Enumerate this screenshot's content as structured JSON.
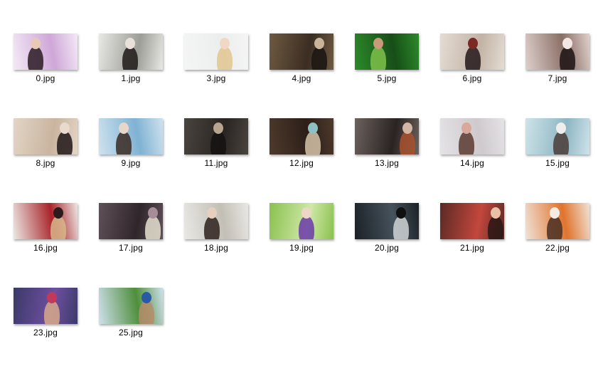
{
  "files": [
    {
      "name": "0.jpg",
      "colors": [
        "#f3e9f5",
        "#cfa7d9",
        "#2a1a22",
        "#e8c9b8"
      ]
    },
    {
      "name": "1.jpg",
      "colors": [
        "#e8e8e4",
        "#9d9d97",
        "#1d1a18",
        "#e9e0d9"
      ]
    },
    {
      "name": "3.jpg",
      "colors": [
        "#f4f5f4",
        "#eceeed",
        "#e1c58f",
        "#f1d8c6"
      ]
    },
    {
      "name": "4.jpg",
      "colors": [
        "#6f5a42",
        "#3b2d22",
        "#1a1512",
        "#c9b59b"
      ]
    },
    {
      "name": "5.jpg",
      "colors": [
        "#2d8a2a",
        "#174e18",
        "#7fc14a",
        "#c89a7a"
      ]
    },
    {
      "name": "6.jpg",
      "colors": [
        "#e4dcd3",
        "#c3b3a6",
        "#24181a",
        "#7a2a24"
      ]
    },
    {
      "name": "7.jpg",
      "colors": [
        "#dfd0cc",
        "#8a6f66",
        "#1c1414",
        "#f2e7e2"
      ]
    },
    {
      "name": "8.jpg",
      "colors": [
        "#e3d5c6",
        "#c9b49f",
        "#1e1616",
        "#e9d9cf"
      ]
    },
    {
      "name": "9.jpg",
      "colors": [
        "#cfe2ee",
        "#7fb2d3",
        "#3a2a22",
        "#e8d6c8"
      ]
    },
    {
      "name": "11.jpg",
      "colors": [
        "#4a443f",
        "#2a2522",
        "#151212",
        "#b7a590"
      ]
    },
    {
      "name": "12.jpg",
      "colors": [
        "#4e3a2c",
        "#2b1f18",
        "#d6c3a9",
        "#8ec0c4"
      ]
    },
    {
      "name": "13.jpg",
      "colors": [
        "#6c625e",
        "#2a2322",
        "#a8512e",
        "#d2b5a2"
      ]
    },
    {
      "name": "14.jpg",
      "colors": [
        "#e4e3e6",
        "#cfc9cc",
        "#5b3a30",
        "#d9a89a"
      ]
    },
    {
      "name": "15.jpg",
      "colors": [
        "#cfe3e9",
        "#8db6c3",
        "#4a3d3a",
        "#f0eded"
      ]
    },
    {
      "name": "16.jpg",
      "colors": [
        "#ece8e4",
        "#a9232a",
        "#d7b78a",
        "#2a1b1c"
      ]
    },
    {
      "name": "17.jpg",
      "colors": [
        "#5f5058",
        "#2f262a",
        "#e5e0cf",
        "#a68d96"
      ]
    },
    {
      "name": "18.jpg",
      "colors": [
        "#e9e8e4",
        "#c3bfb6",
        "#2e211c",
        "#e6cfbc"
      ]
    },
    {
      "name": "19.jpg",
      "colors": [
        "#8ac14e",
        "#cfe7a8",
        "#6a3aa8",
        "#ecd7c6"
      ]
    },
    {
      "name": "20.jpg",
      "colors": [
        "#1b2126",
        "#46525c",
        "#cfd3d5",
        "#0e1012"
      ]
    },
    {
      "name": "21.jpg",
      "colors": [
        "#5a2a25",
        "#c3473d",
        "#2a1615",
        "#e9c0a8"
      ]
    },
    {
      "name": "22.jpg",
      "colors": [
        "#f0e2d6",
        "#e0742e",
        "#4a2f22",
        "#f4ece4"
      ]
    },
    {
      "name": "23.jpg",
      "colors": [
        "#3b3a68",
        "#6e4fa0",
        "#d8a98a",
        "#c23a5a"
      ]
    },
    {
      "name": "25.jpg",
      "colors": [
        "#cfe0ec",
        "#4f8e3c",
        "#b68c6a",
        "#2a5aa6"
      ]
    }
  ]
}
